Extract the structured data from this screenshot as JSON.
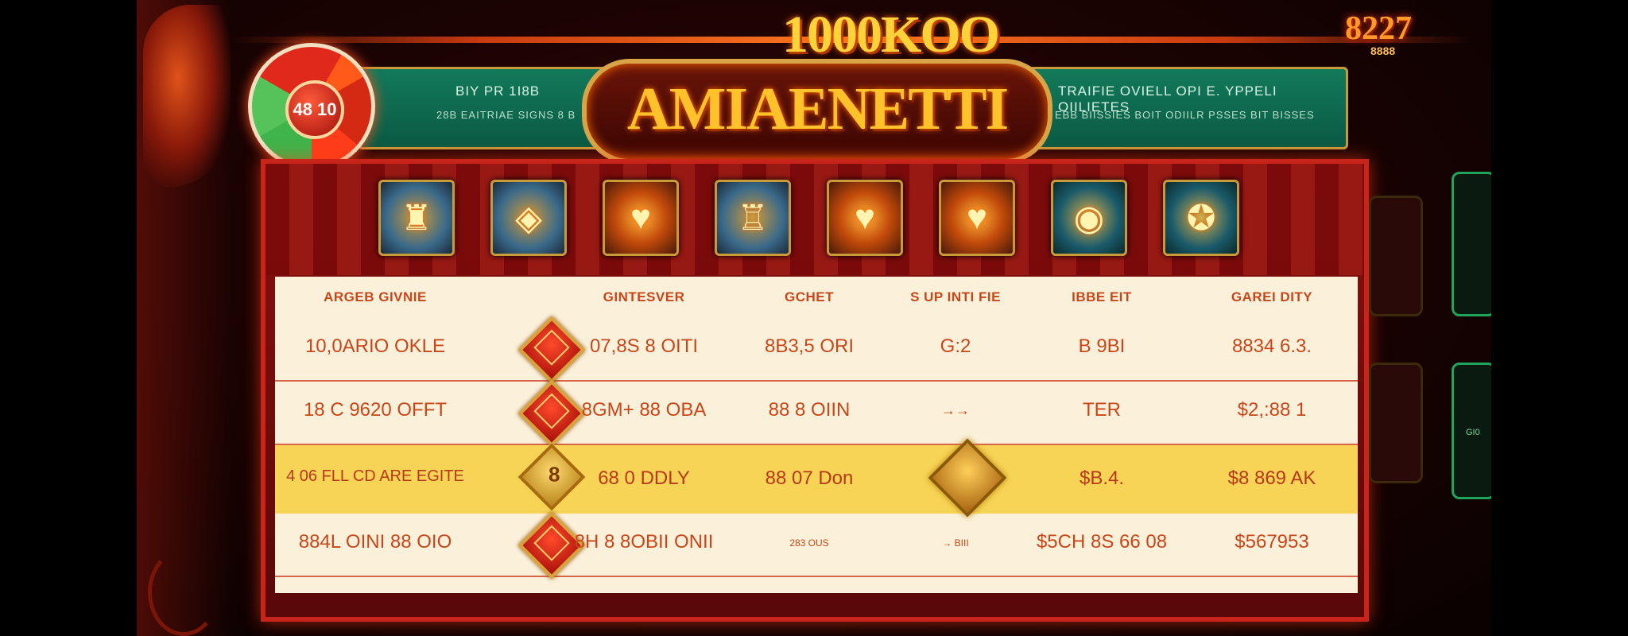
{
  "header": {
    "title_top": "1000KOO",
    "top_right_number": "8227",
    "top_right_sub": "8888",
    "plaque_title": "AMIAENETTI"
  },
  "wheel": {
    "label": "48 10"
  },
  "banner_left": {
    "line1": "BIY PR 1I8B",
    "line2": "28B EAITRIAE SIGNS 8 B"
  },
  "banner_right": {
    "line1": "TRAIFIE OVIELL OPI E. YPPELI OIILIETES",
    "line2": "EBB BIISSIES BOIT ODIILR PSSES BIT BISSES"
  },
  "symbols": [
    {
      "name": "tower-symbol",
      "glyph": "♜",
      "style": "blue"
    },
    {
      "name": "emblem-symbol",
      "glyph": "◈",
      "style": "blue"
    },
    {
      "name": "flaming-heart-symbol",
      "glyph": "♥",
      "style": "fire"
    },
    {
      "name": "castle-symbol",
      "glyph": "♖",
      "style": "blue"
    },
    {
      "name": "flaming-heart-symbol-2",
      "glyph": "♥",
      "style": "fire"
    },
    {
      "name": "flaming-heart-symbol-3",
      "glyph": "♥",
      "style": "fire"
    },
    {
      "name": "globe-symbol",
      "glyph": "◉",
      "style": "teal"
    },
    {
      "name": "seal-symbol",
      "glyph": "✪",
      "style": "teal"
    }
  ],
  "table": {
    "headers": [
      "ARGEB GIVNIE",
      "GINTESVER",
      "GCHET",
      "S UP INTI FIE",
      "IBBE EIT",
      "GAREI DITY"
    ],
    "rows": [
      {
        "c1": "10,0ARIO OKLE",
        "c2": "07,8S 8 OITI",
        "c3": "8B3,5 ORI",
        "c4": "G:2",
        "c5": "B 9BI",
        "c6": "8834 6.3.",
        "marker": "gem"
      },
      {
        "c1": "18 C 9620 OFFT",
        "c2": "8GM+ 88 OBA",
        "c3": "88 8 OIIN",
        "c4": "→→",
        "c5": "TER",
        "c6": "$2,:88 1",
        "marker": "gem"
      },
      {
        "c1": "4 06  FLL CD ARE EGITE",
        "c2": "68 0 DDLY",
        "c3": "88 07 Don",
        "c4": "",
        "c5": "$B.4.",
        "c6": "$8 869 AK",
        "marker": "coin",
        "coin_label": "8"
      },
      {
        "c1": "884L OINI 88 OIO",
        "c2": "8H 8 8OBII ONII",
        "c3": "283 OUS",
        "c4": "→ BIII",
        "c5": "$5CH 8S 66 08",
        "c6": "$567953",
        "marker": "gem"
      }
    ]
  },
  "right_side": {
    "label": "GI0"
  }
}
